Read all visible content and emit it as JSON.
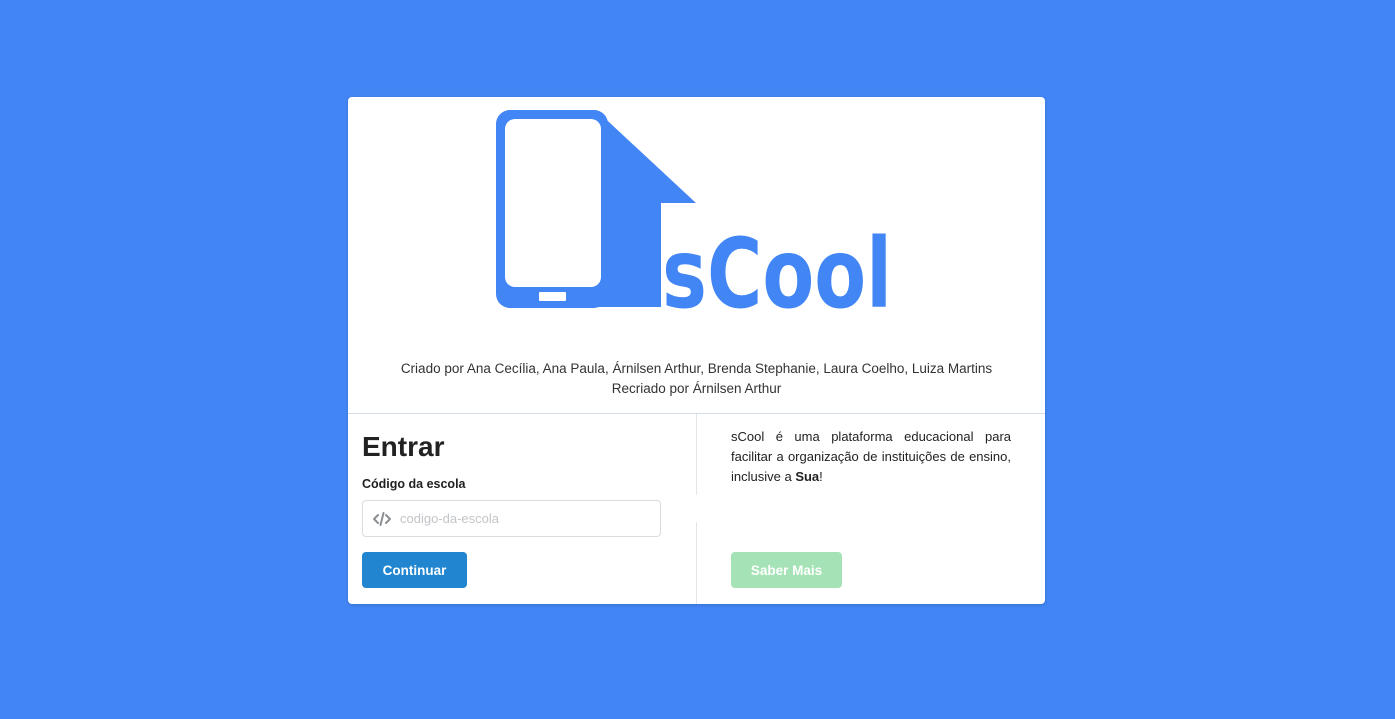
{
  "brand": {
    "logo_text": "sCool",
    "accent_color": "#4285f4"
  },
  "credits": {
    "line1": "Criado por Ana Cecília, Ana Paula, Árnilsen Arthur, Brenda Stephanie, Laura Coelho, Luiza Martins",
    "line2": "Recriado por Árnilsen Arthur"
  },
  "login": {
    "heading": "Entrar",
    "field_label": "Código da escola",
    "placeholder": "codigo-da-escola",
    "value": "",
    "icon": "code-icon",
    "submit_label": "Continuar",
    "submit_color": "#2185d0"
  },
  "about": {
    "text_before": "sCool é uma plataforma educacional para facilitar a organização de instituições de ensino, inclusive a ",
    "text_bold": "Sua",
    "text_after": "!",
    "button_label": "Saber Mais",
    "button_color": "#a5e3b6"
  }
}
